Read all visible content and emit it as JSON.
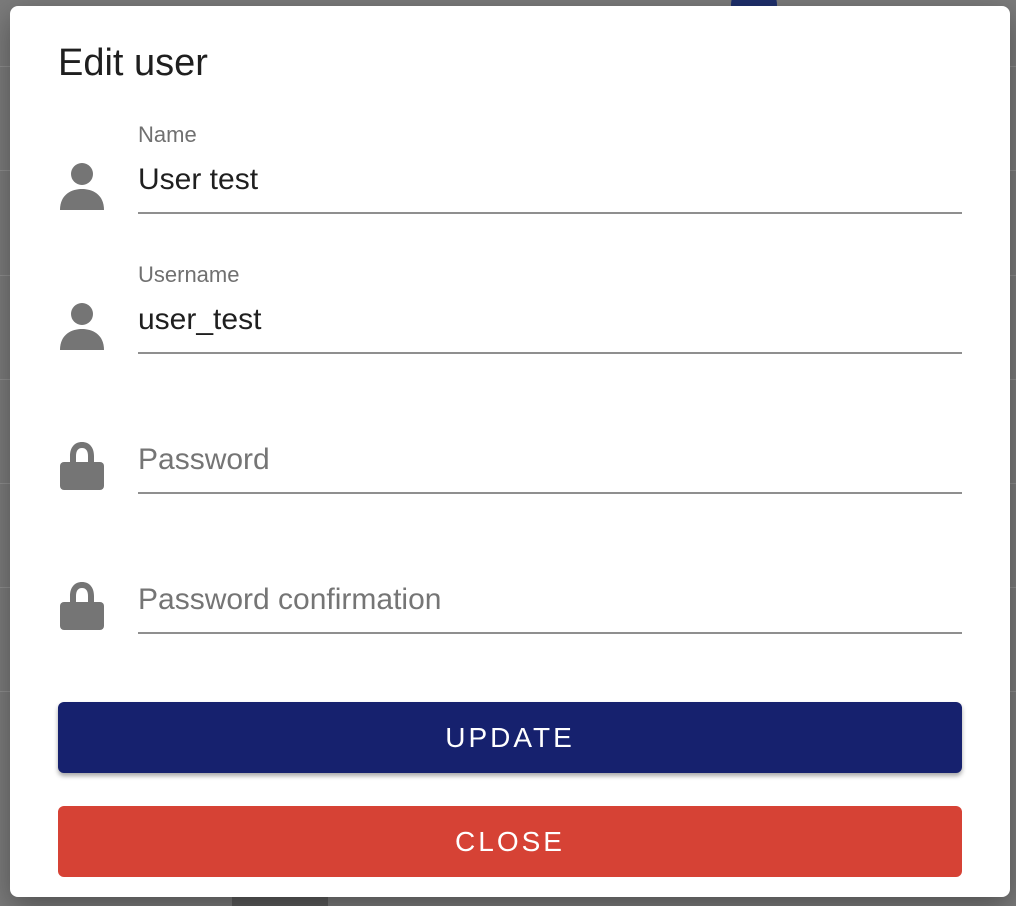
{
  "dialog": {
    "title": "Edit user"
  },
  "fields": {
    "name": {
      "label": "Name",
      "value": "User test",
      "icon": "person-icon"
    },
    "username": {
      "label": "Username",
      "value": "user_test",
      "icon": "person-icon"
    },
    "password": {
      "placeholder": "Password",
      "value": "",
      "icon": "lock-icon"
    },
    "password_confirmation": {
      "placeholder": "Password confirmation",
      "value": "",
      "icon": "lock-icon"
    }
  },
  "actions": {
    "update_label": "UPDATE",
    "close_label": "CLOSE"
  },
  "colors": {
    "primary": "#16216e",
    "danger": "#d64235",
    "icon": "#757575",
    "underline": "#8f8f8f"
  }
}
